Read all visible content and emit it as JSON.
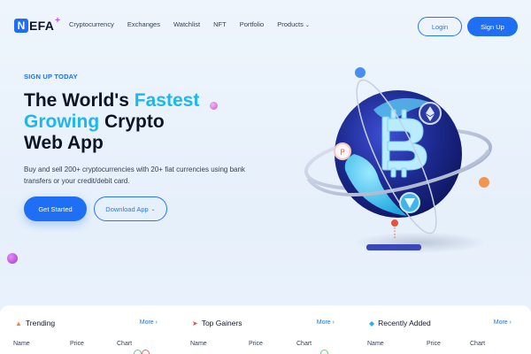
{
  "brand": {
    "logo_letter": "N",
    "logo_rest": "EFA",
    "logo_plus": "+"
  },
  "nav": {
    "links": [
      "Cryptocurrency",
      "Exchanges",
      "Watchlist",
      "NFT",
      "Portfolio",
      "Products"
    ],
    "login_label": "Login",
    "signup_label": "Sign Up"
  },
  "hero": {
    "eyebrow": "SIGN UP TODAY",
    "headline_part1": "The World's ",
    "headline_fast": "Fastest",
    "headline_growing": "Growing",
    "headline_part2": " Crypto",
    "headline_part3": "Web App",
    "subtext": "Buy and sell 200+ cryptocurrencies with 20+ fiat currencies using bank transfers or your credit/debit card.",
    "cta_primary": "Get Started",
    "cta_secondary": "Download App"
  },
  "panels": [
    {
      "title": "Trending",
      "icon": "fire-icon",
      "more": "More",
      "headers": [
        "Name",
        "Price",
        "Chart"
      ]
    },
    {
      "title": "Top Gainers",
      "icon": "rocket-icon",
      "more": "More",
      "headers": [
        "Name",
        "Price",
        "Chart"
      ]
    },
    {
      "title": "Recently Added",
      "icon": "diamond-icon",
      "more": "More",
      "headers": [
        "Name",
        "Price",
        "Chart"
      ]
    }
  ],
  "colors": {
    "accent": "#1f6ff5",
    "highlight": "#1fb6ef",
    "heading": "#0b1526",
    "background": "#eaf3fc"
  }
}
